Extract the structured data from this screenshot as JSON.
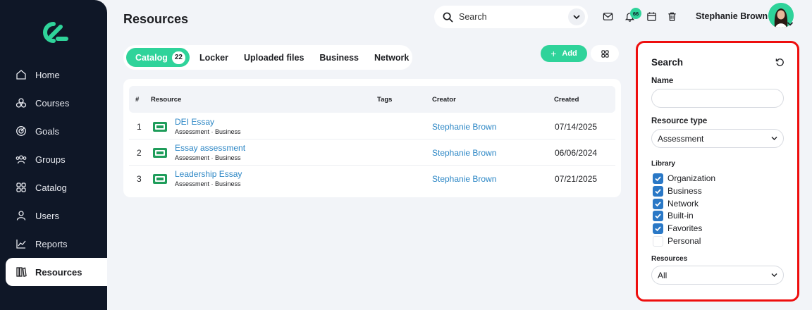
{
  "sidebar": {
    "items": [
      {
        "label": "Home",
        "icon": "home-icon"
      },
      {
        "label": "Courses",
        "icon": "courses-icon"
      },
      {
        "label": "Goals",
        "icon": "goals-icon"
      },
      {
        "label": "Groups",
        "icon": "groups-icon"
      },
      {
        "label": "Catalog",
        "icon": "catalog-icon"
      },
      {
        "label": "Users",
        "icon": "user-icon"
      },
      {
        "label": "Reports",
        "icon": "reports-icon"
      },
      {
        "label": "Resources",
        "icon": "resources-icon"
      }
    ],
    "active_index": 7
  },
  "header": {
    "title": "Resources",
    "search_placeholder": "Search",
    "notification_count": "66",
    "user_name": "Stephanie Brown"
  },
  "tabs": [
    {
      "label": "Catalog",
      "count": "22",
      "active": true
    },
    {
      "label": "Locker"
    },
    {
      "label": "Uploaded files"
    },
    {
      "label": "Business"
    },
    {
      "label": "Network"
    }
  ],
  "actions": {
    "add_label": "Add"
  },
  "table": {
    "columns": {
      "num": "#",
      "resource": "Resource",
      "tags": "Tags",
      "creator": "Creator",
      "created": "Created"
    },
    "rows": [
      {
        "num": "1",
        "title": "DEI Essay",
        "subtitle": "Assessment · Business",
        "creator": "Stephanie Brown",
        "created": "07/14/2025"
      },
      {
        "num": "2",
        "title": "Essay assessment",
        "subtitle": "Assessment · Business",
        "creator": "Stephanie Brown",
        "created": "06/06/2024"
      },
      {
        "num": "3",
        "title": "Leadership Essay",
        "subtitle": "Assessment · Business",
        "creator": "Stephanie Brown",
        "created": "07/21/2025"
      }
    ]
  },
  "search_panel": {
    "title": "Search",
    "name_label": "Name",
    "name_value": "",
    "resource_type_label": "Resource type",
    "resource_type_value": "Assessment",
    "library_label": "Library",
    "library": [
      {
        "label": "Organization",
        "checked": true
      },
      {
        "label": "Business",
        "checked": true
      },
      {
        "label": "Network",
        "checked": true
      },
      {
        "label": "Built-in",
        "checked": true
      },
      {
        "label": "Favorites",
        "checked": true
      },
      {
        "label": "Personal",
        "checked": false
      }
    ],
    "resources_label": "Resources",
    "resources_value": "All"
  },
  "colors": {
    "accent": "#2fd39a",
    "sidebar": "#0f1727",
    "link": "#2b86c5",
    "checkbox": "#2a78c6",
    "highlight_border": "#ee0e0e"
  }
}
